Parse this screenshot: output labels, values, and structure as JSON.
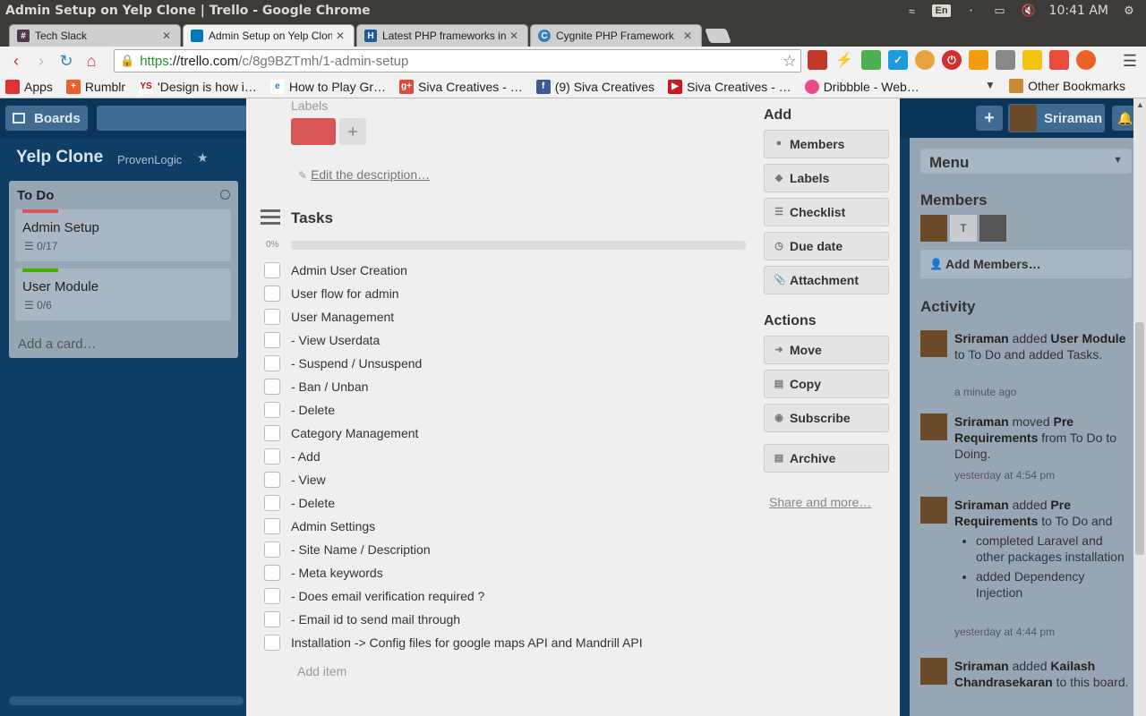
{
  "window": {
    "title": "Admin Setup on Yelp Clone | Trello - Google Chrome",
    "lang": "En",
    "time": "10:41 AM"
  },
  "tabs": [
    {
      "label": "Tech Slack",
      "icon": "slack-icon",
      "color": "#4d394b",
      "glyph": "#"
    },
    {
      "label": "Admin Setup on Yelp Clon",
      "icon": "trello-icon",
      "color": "#0079bf",
      "glyph": ""
    },
    {
      "label": "Latest PHP frameworks in",
      "icon": "hp-icon",
      "color": "#1e5aa0",
      "glyph": "H"
    },
    {
      "label": "Cygnite PHP Framework",
      "icon": "cygnite-icon",
      "color": "#3a7fc1",
      "glyph": "C"
    }
  ],
  "address": {
    "https": "https",
    "host": "://trello.com",
    "path": "/c/8g9BZTmh/1-admin-setup"
  },
  "bookmarks": [
    {
      "label": "Apps",
      "icon": "apps-grid-icon",
      "color": "#d33"
    },
    {
      "label": "Rumblr",
      "icon": "rumblr-icon",
      "color": "#e8622a"
    },
    {
      "label": "'Design is how i…",
      "icon": "ys-icon",
      "color": "#c00"
    },
    {
      "label": "How to Play Gr…",
      "icon": "e-icon",
      "color": "#2a7ad3"
    },
    {
      "label": "Siva Creatives - …",
      "icon": "google-plus-icon",
      "color": "#dd4b39"
    },
    {
      "label": "(9) Siva Creatives",
      "icon": "facebook-icon",
      "color": "#3b5998"
    },
    {
      "label": "Siva Creatives - …",
      "icon": "youtube-icon",
      "color": "#cc181e"
    },
    {
      "label": "Dribbble - Web…",
      "icon": "dribbble-icon",
      "color": "#ea4c89"
    }
  ],
  "other_bookmarks": "Other Bookmarks",
  "header": {
    "boards": "Boards",
    "user": "Sriraman"
  },
  "board": {
    "title": "Yelp Clone",
    "team": "ProvenLogic"
  },
  "list": {
    "title": "To Do",
    "cards": [
      {
        "title": "Admin Setup",
        "badge": "0/17",
        "label_color": "#d85655"
      },
      {
        "title": "User Module",
        "badge": "0/6",
        "label_color": "#3cb500"
      }
    ],
    "add_card": "Add a card…"
  },
  "card": {
    "labels_heading": "Labels",
    "label_color": "#d85655",
    "edit_description": "Edit the description…",
    "checklist_title": "Tasks",
    "progress_text": "0%",
    "progress": 0,
    "items": [
      "Admin User Creation",
      "User flow for admin",
      "User Management",
      "- View Userdata",
      "- Suspend / Unsuspend",
      "- Ban / Unban",
      "- Delete",
      "Category Management",
      "- Add",
      "- View",
      "- Delete",
      "Admin Settings",
      "- Site Name / Description",
      "- Meta keywords",
      "- Does email verification required ?",
      "- Email id to send mail through",
      "Installation -> Config files for google maps API and Mandrill API"
    ],
    "add_item": "Add item"
  },
  "add": {
    "heading": "Add",
    "members": "Members",
    "labels": "Labels",
    "checklist": "Checklist",
    "due_date": "Due date",
    "attachment": "Attachment"
  },
  "actions": {
    "heading": "Actions",
    "move": "Move",
    "copy": "Copy",
    "subscribe": "Subscribe",
    "archive": "Archive",
    "share": "Share and more…"
  },
  "sidebar": {
    "menu": "Menu",
    "members_heading": "Members",
    "member_initial": "T",
    "add_members": "Add Members…",
    "activity_heading": "Activity",
    "activity": [
      {
        "user": "Sriraman",
        "verb": " added ",
        "obj": "User Module",
        "rest": " to To Do and added Tasks.",
        "time": "a minute ago"
      },
      {
        "user": "Sriraman",
        "verb": " moved ",
        "obj": "Pre Requirements",
        "rest": " from To Do to Doing.",
        "time": "yesterday at 4:54 pm"
      },
      {
        "user": "Sriraman",
        "verb": " added ",
        "obj": "Pre Requirements",
        "rest": " to To Do and",
        "bullets": [
          "completed Laravel and other packages installation",
          "added Dependency Injection"
        ],
        "time": "yesterday at 4:44 pm"
      },
      {
        "user": "Sriraman",
        "verb": " added ",
        "obj": "Kailash Chandrasekaran",
        "rest": " to this board."
      }
    ]
  }
}
